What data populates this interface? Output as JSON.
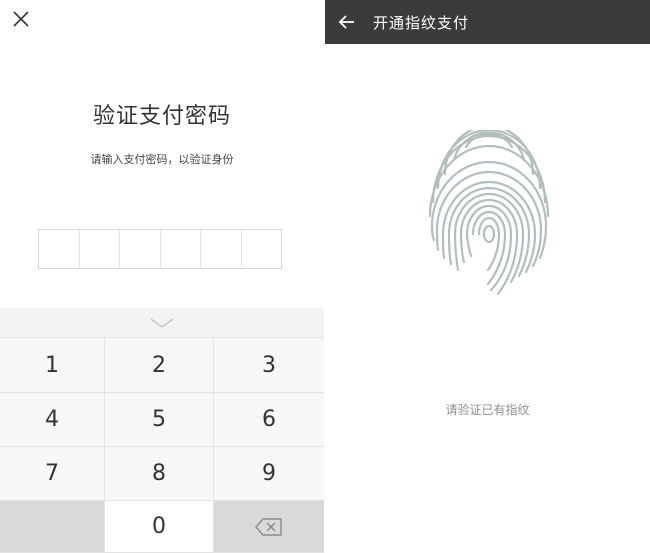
{
  "left_panel": {
    "close_icon": "close-icon",
    "title": "验证支付密码",
    "subtitle": "请输入支付密码，以验证身份",
    "pin_length": 6,
    "keyboard": {
      "collapse_icon": "chevron-down-icon",
      "keys": [
        "1",
        "2",
        "3",
        "4",
        "5",
        "6",
        "7",
        "8",
        "9",
        "",
        "0",
        ""
      ],
      "delete_icon": "backspace-icon"
    }
  },
  "right_panel": {
    "back_icon": "arrow-left-icon",
    "title": "开通指纹支付",
    "fingerprint_icon": "fingerprint-icon",
    "hint": "请验证已有指纹"
  },
  "colors": {
    "topbar_bg": "#3a3b3d",
    "fingerprint_stroke": "#b3bfbb",
    "keyboard_bg": "#f3f3f3",
    "special_key_bg": "#d9d9d9"
  }
}
